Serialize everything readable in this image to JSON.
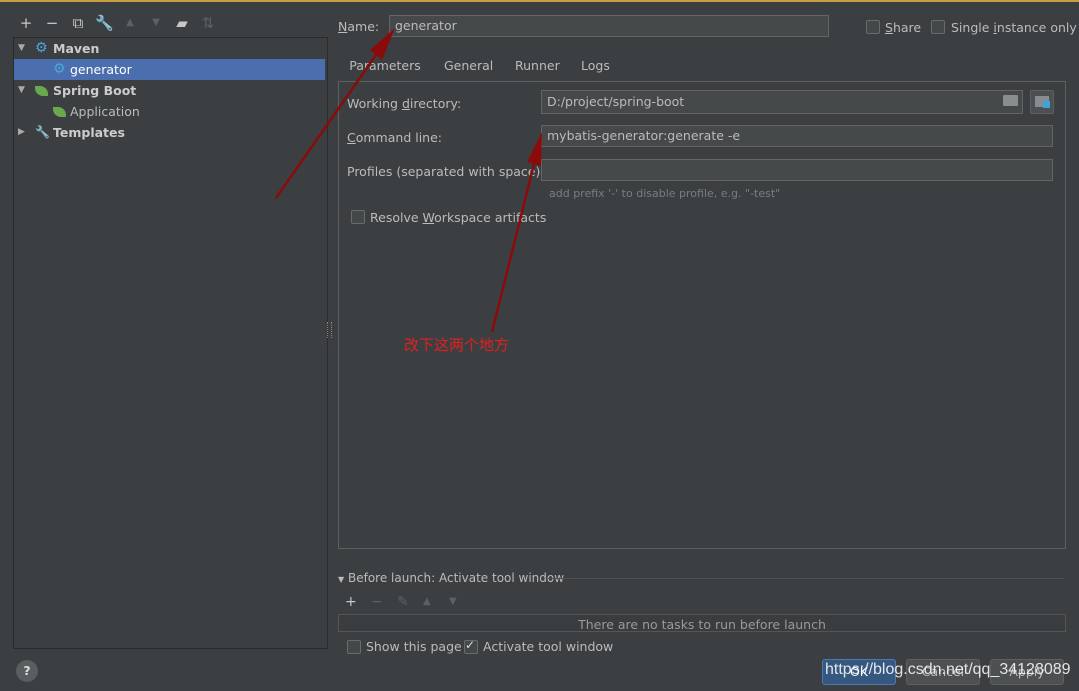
{
  "toolbar": {
    "icons": [
      "add-icon",
      "remove-icon",
      "copy-icon",
      "wrench-icon",
      "move-up-icon",
      "move-down-icon",
      "folder-add-icon",
      "sort-icon"
    ]
  },
  "tree": {
    "groups": [
      {
        "label": "Maven",
        "icon": "gear-icon",
        "children": [
          {
            "label": "generator",
            "selected": true
          }
        ]
      },
      {
        "label": "Spring Boot",
        "icon": "spring-boot-icon",
        "children": [
          {
            "label": "Application",
            "selected": false
          }
        ]
      },
      {
        "label": "Templates",
        "icon": "wrench-icon",
        "children": []
      }
    ]
  },
  "header": {
    "name_label_mnemonic": "N",
    "name_label_rest": "ame:",
    "name_value": "generator",
    "share_label_mnemonic": "S",
    "share_label_rest": "hare",
    "single_instance_label_a": "Single ",
    "single_instance_label_mnemonic": "i",
    "single_instance_label_b": "nstance only"
  },
  "tabs": [
    "Parameters",
    "General",
    "Runner",
    "Logs"
  ],
  "params": {
    "working_dir_label_a": "Working ",
    "working_dir_label_mnemonic": "d",
    "working_dir_label_b": "irectory:",
    "working_dir_value": "D:/project/spring-boot",
    "command_label_mnemonic": "C",
    "command_label_rest": "ommand line:",
    "command_value": "mybatis-generator:generate -e",
    "profiles_label": "Profiles (separated with space)",
    "profiles_value": "",
    "profiles_hint": "add prefix '-' to disable profile, e.g. \"-test\"",
    "resolve_label_a": "Resolve ",
    "resolve_label_mnemonic": "W",
    "resolve_label_b": "orkspace artifacts"
  },
  "annotation": "改下这两个地方",
  "before_launch": {
    "title": "Before launch: Activate tool window",
    "empty_text": "There are no tasks to run before launch",
    "show_page_label": "Show this page",
    "activate_label": "Activate tool window"
  },
  "footer": {
    "help_label": "?",
    "ok_label": "OK",
    "cancel_label": "Cancel",
    "apply_label": "Apply",
    "watermark": "https://blog.csdn.net/qq_34128089"
  },
  "colors": {
    "background": "#3c3f41",
    "selection": "#4b6eaf",
    "tab_underline": "#4a88c7",
    "annotation_red": "#e02020",
    "arrow": "#8b0a0a"
  }
}
